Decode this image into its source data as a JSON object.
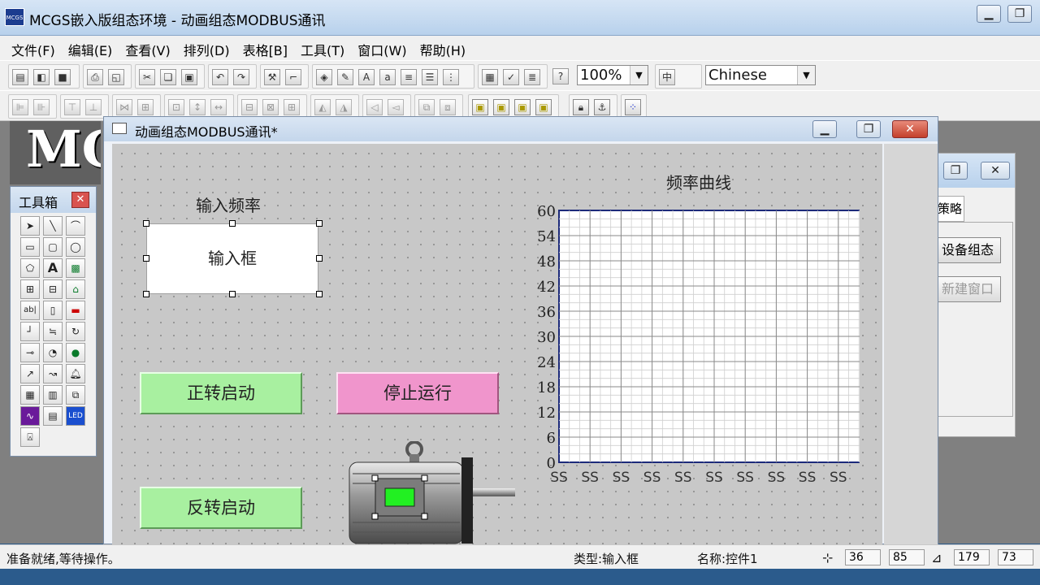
{
  "app": {
    "title": "MCGS嵌入版组态环境 - 动画组态MODBUS通讯",
    "logo_text": "MCGS"
  },
  "menu": [
    "文件(F)",
    "编辑(E)",
    "查看(V)",
    "排列(D)",
    "表格[B]",
    "工具(T)",
    "窗口(W)",
    "帮助(H)"
  ],
  "toolbar": {
    "zoom": "100%",
    "language": "Chinese"
  },
  "bg_logo": "MC",
  "toolbox": {
    "title": "工具箱"
  },
  "workbench": {
    "tab": "策略",
    "buttons": [
      "设备组态",
      "新建窗口"
    ]
  },
  "child_window": {
    "title": "动画组态MODBUS通讯*"
  },
  "canvas": {
    "freq_label": "输入频率",
    "input_box": "输入框",
    "btn_forward": "正转启动",
    "btn_stop": "停止运行",
    "btn_reverse": "反转启动"
  },
  "chart_data": {
    "type": "line",
    "title": "频率曲线",
    "yticks": [
      "0",
      "6",
      "12",
      "18",
      "24",
      "30",
      "36",
      "42",
      "48",
      "54",
      "60"
    ],
    "xticks": [
      "SS",
      "SS",
      "SS",
      "SS",
      "SS",
      "SS",
      "SS",
      "SS",
      "SS",
      "SS",
      "SS"
    ],
    "ylim": [
      0,
      60
    ],
    "grid": true,
    "series": []
  },
  "status": {
    "ready": "准备就绪,等待操作。",
    "type": "类型:输入框",
    "name": "名称:控件1",
    "x": "36",
    "y": "85",
    "w": "179",
    "h": "73"
  }
}
